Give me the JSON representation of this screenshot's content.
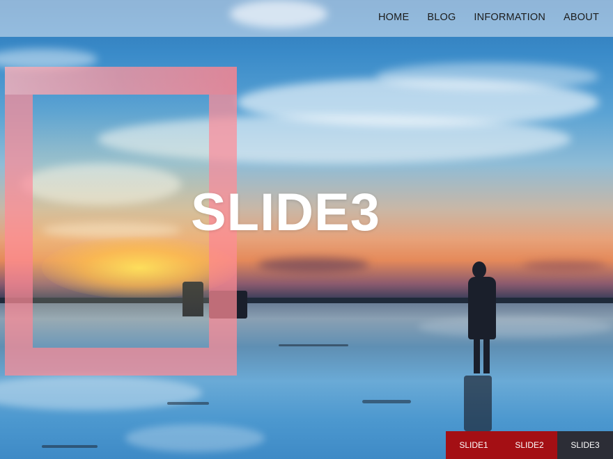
{
  "nav": {
    "items": [
      {
        "label": "HOME"
      },
      {
        "label": "BLOG"
      },
      {
        "label": "INFORMATION"
      },
      {
        "label": "ABOUT"
      }
    ]
  },
  "hero": {
    "title": "SLIDE3"
  },
  "pager": {
    "tabs": [
      {
        "label": "SLIDE1",
        "active": false
      },
      {
        "label": "SLIDE2",
        "active": false
      },
      {
        "label": "SLIDE3",
        "active": true
      }
    ]
  },
  "colors": {
    "pager_tab": "#a40f14",
    "pager_active": "#2c2d36",
    "frame_overlay": "#ff8c96",
    "title_text": "#ffffff"
  }
}
